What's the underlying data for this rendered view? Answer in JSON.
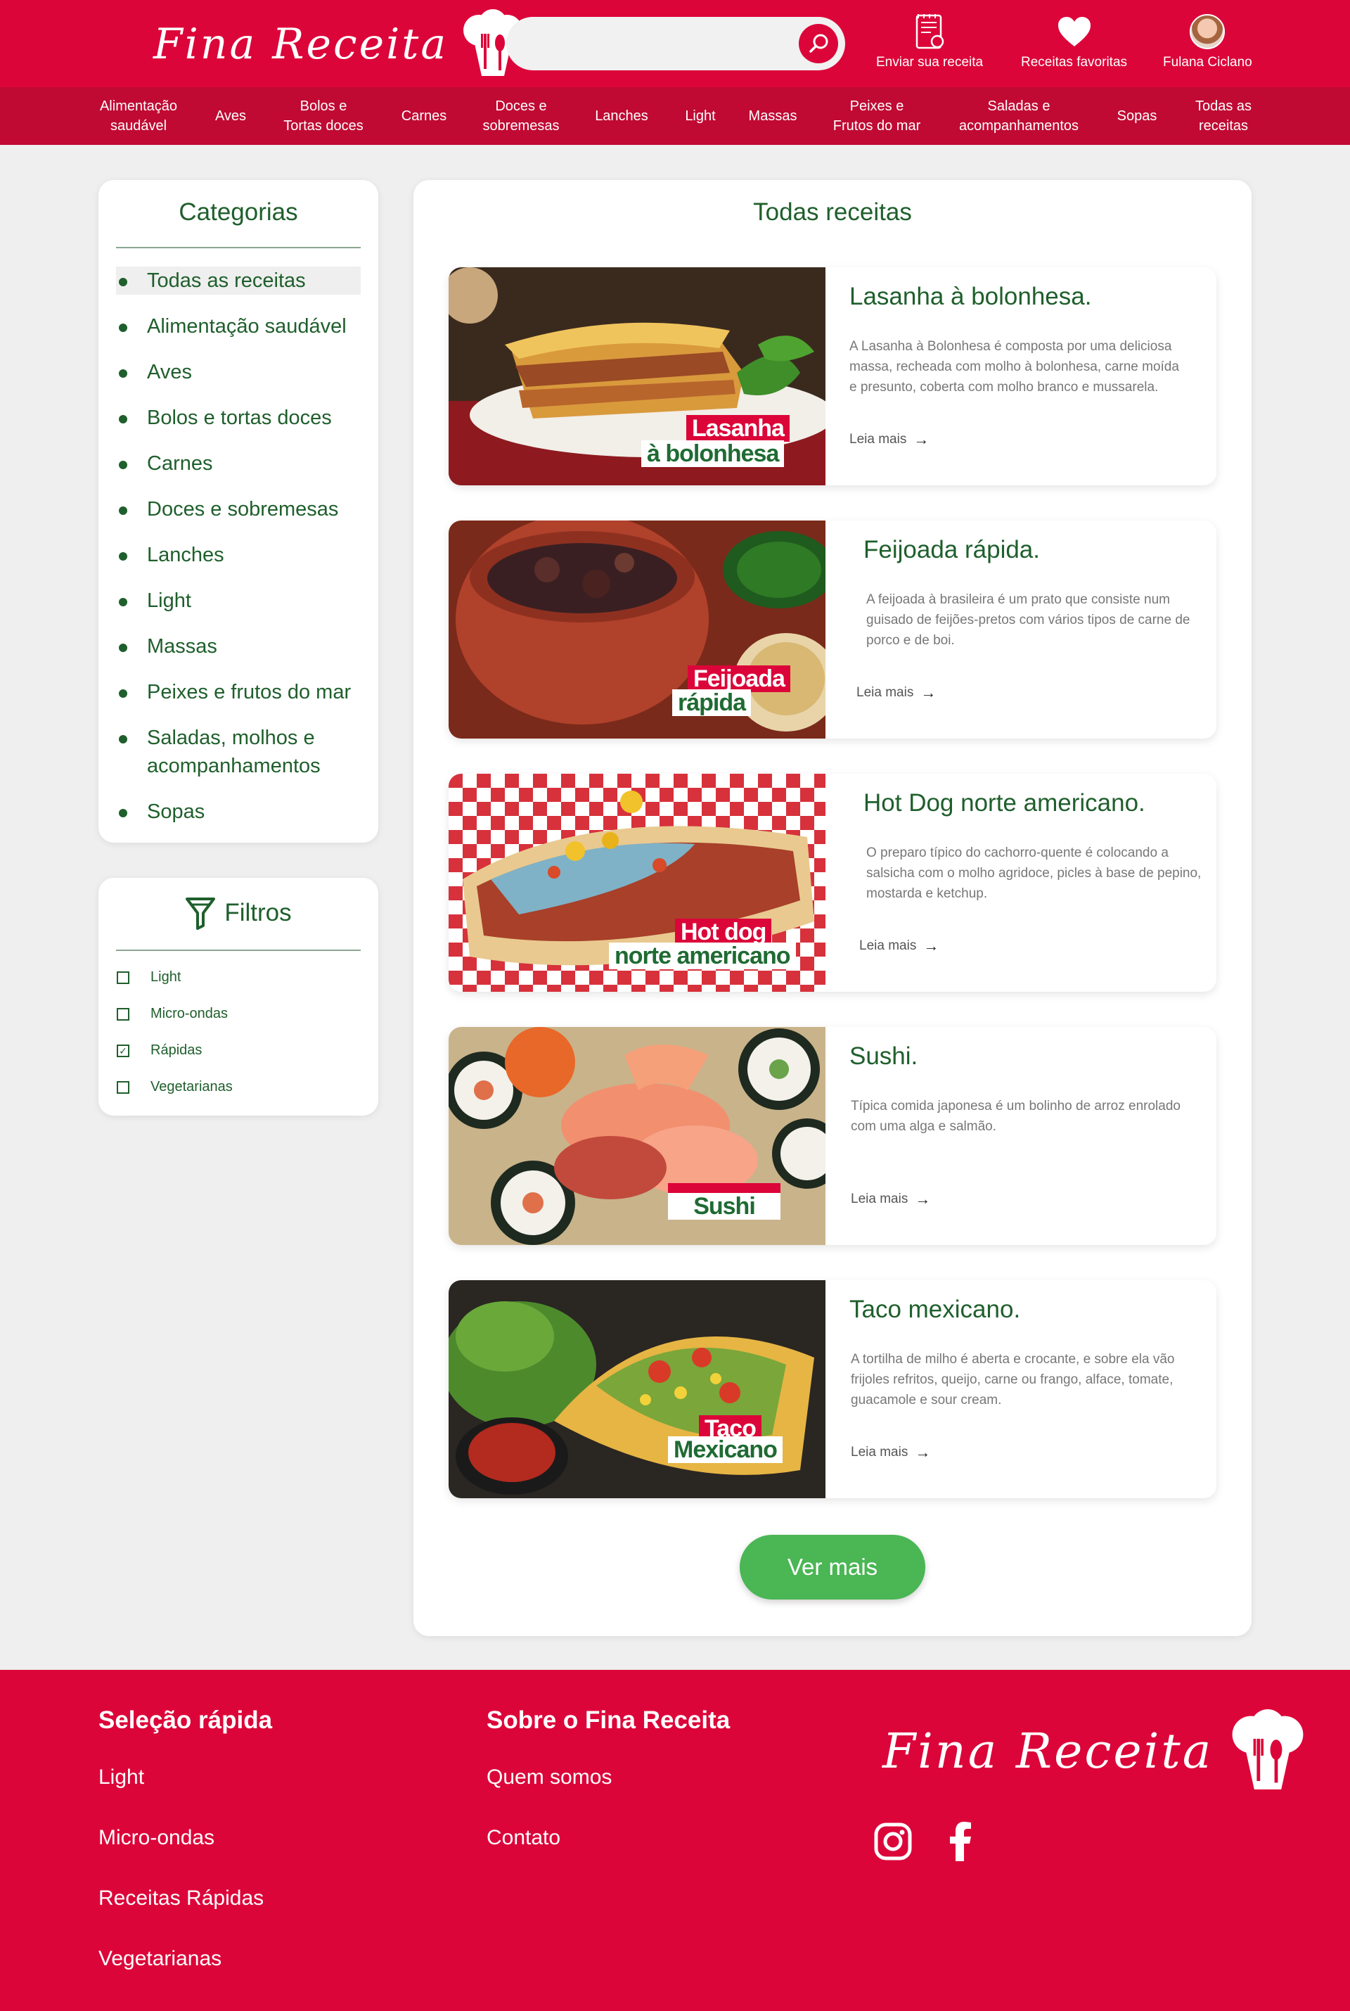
{
  "brand": {
    "name": "Fina Receita"
  },
  "search": {
    "placeholder": ""
  },
  "header_actions": {
    "send": "Enviar sua receita",
    "favorites": "Receitas favoritas",
    "user": "Fulana Ciclano"
  },
  "nav": [
    "Alimentação\nsaudável",
    "Aves",
    "Bolos e\nTortas doces",
    "Carnes",
    "Doces e\nsobremesas",
    "Lanches",
    "Light",
    "Massas",
    "Peixes e\nFrutos do mar",
    "Saladas e\nacompanhamentos",
    "Sopas",
    "Todas as\nreceitas"
  ],
  "categories": {
    "title": "Categorias",
    "items": [
      "Todas as receitas",
      "Alimentação saudável",
      "Aves",
      "Bolos e tortas doces",
      "Carnes",
      "Doces e sobremesas",
      "Lanches",
      "Light",
      "Massas",
      "Peixes e frutos do mar",
      "Saladas, molhos e acompanhamentos",
      "Sopas"
    ]
  },
  "filters": {
    "title": "Filtros",
    "items": [
      {
        "label": "Light",
        "checked": false
      },
      {
        "label": "Micro-ondas",
        "checked": false
      },
      {
        "label": "Rápidas",
        "checked": true
      },
      {
        "label": "Vegetarianas",
        "checked": false
      }
    ]
  },
  "main": {
    "title": "Todas receitas",
    "more_label": "Ver mais",
    "read_more": "Leia mais",
    "recipes": [
      {
        "title": "Lasanha à bolonhesa.",
        "desc": "A Lasanha à Bolonhesa é composta por uma deliciosa massa, recheada com molho à bolonhesa, carne moída e presunto, coberta com molho branco e mussarela.",
        "img_line1": "Lasanha",
        "img_line2": "à bolonhesa"
      },
      {
        "title": "Feijoada rápida.",
        "desc": "A feijoada à brasileira é um prato que consiste num guisado de feijões-pretos com vários tipos de carne de porco e de boi.",
        "img_line1": "Feijoada",
        "img_line2": "rápida"
      },
      {
        "title": "Hot Dog norte americano.",
        "desc": "O preparo típico do cachorro-quente é colocando a salsicha com o molho agridoce, picles à base de pepino, mostarda e ketchup.",
        "img_line1": "Hot dog",
        "img_line2": "norte americano"
      },
      {
        "title": "Sushi.",
        "desc": "Típica comida japonesa é um bolinho de arroz enrolado com uma alga e salmão.",
        "img_line1": "",
        "img_line2": "Sushi"
      },
      {
        "title": "Taco mexicano.",
        "desc": "A tortilha de milho é aberta e crocante, e sobre ela vão frijoles refritos, queijo, carne ou frango, alface, tomate, guacamole e sour cream.",
        "img_line1": "Taco",
        "img_line2": "Mexicano"
      }
    ]
  },
  "footer": {
    "quick": {
      "title": "Seleção rápida",
      "links": [
        "Light",
        "Micro-ondas",
        "Receitas Rápidas",
        "Vegetarianas"
      ]
    },
    "about": {
      "title": "Sobre o Fina Receita",
      "links": [
        "Quem somos",
        "Contato"
      ]
    },
    "social": [
      "instagram-icon",
      "facebook-icon"
    ]
  },
  "colors": {
    "brand_red": "#dc0539",
    "nav_red": "#c00a33",
    "green": "#1f5f2c",
    "button_green": "#4ab654"
  }
}
